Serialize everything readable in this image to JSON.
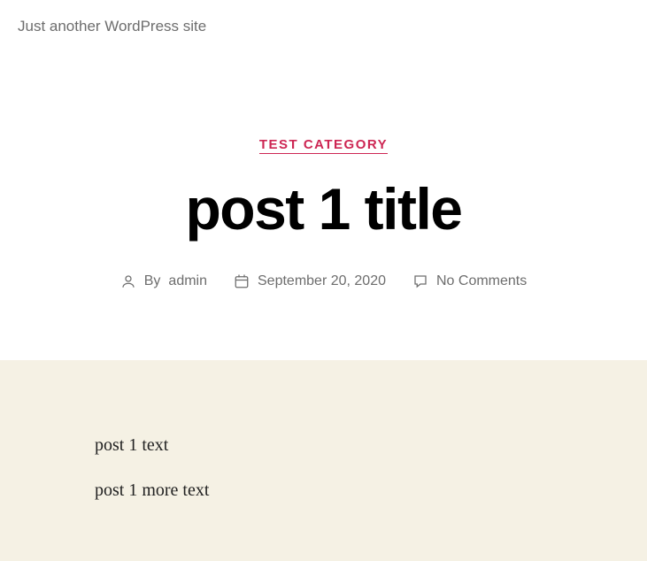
{
  "site": {
    "tagline": "Just another WordPress site"
  },
  "post": {
    "category": "TEST CATEGORY",
    "title": "post 1 title",
    "author_prefix": "By ",
    "author": "admin",
    "date": "September 20, 2020",
    "comments": "No Comments",
    "content": [
      "post 1 text",
      "post 1 more text"
    ]
  }
}
